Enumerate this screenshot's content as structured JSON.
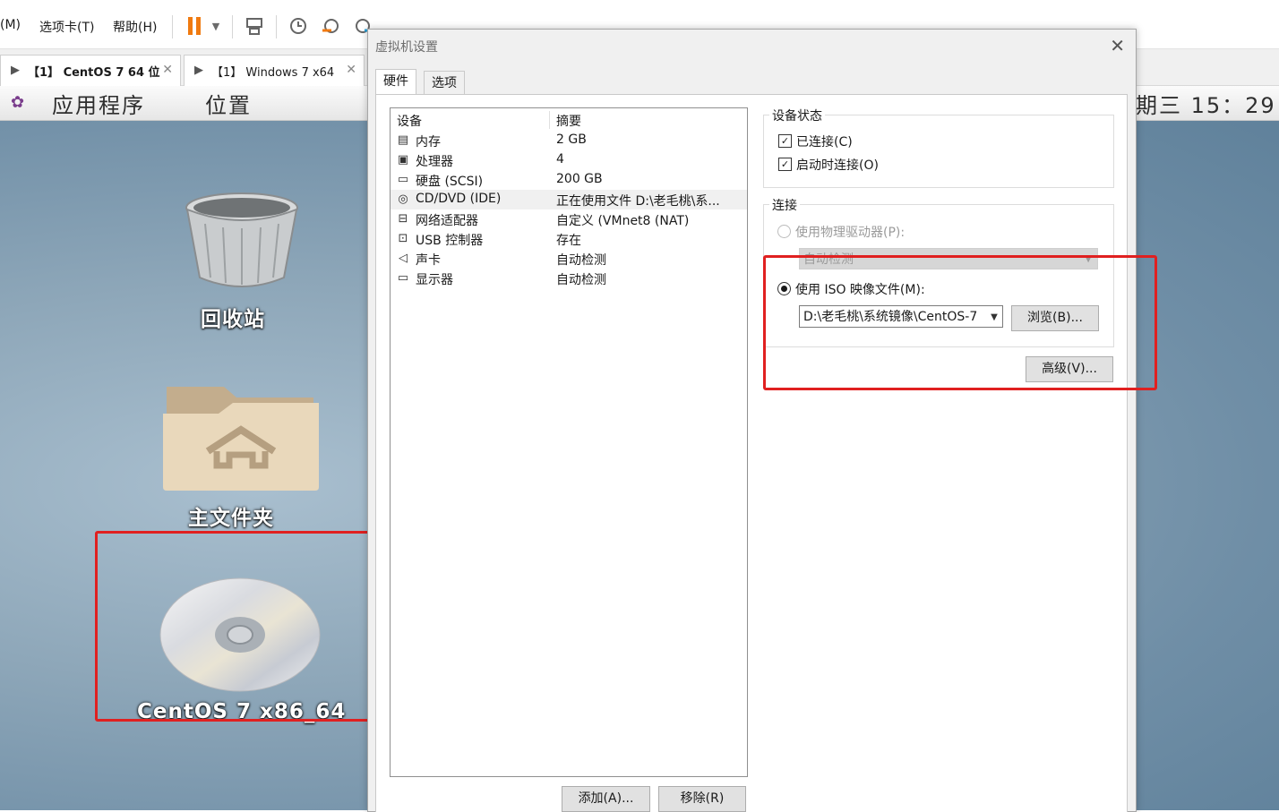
{
  "menubar": {
    "items": [
      "(M)",
      "选项卡(T)",
      "帮助(H)"
    ]
  },
  "tabs": [
    {
      "label": "【1】 CentOS 7 64 位"
    },
    {
      "label": "【1】 Windows 7 x64"
    }
  ],
  "guest": {
    "topbar_apps": "应用程序",
    "topbar_places": "位置",
    "clock": "期三 15：29",
    "icons": [
      {
        "label": "回收站"
      },
      {
        "label": "主文件夹"
      },
      {
        "label": "CentOS 7 x86_64"
      }
    ]
  },
  "dialog": {
    "title": "虚拟机设置",
    "tabs": [
      "硬件",
      "选项"
    ],
    "device_list": {
      "headers": [
        "设备",
        "摘要"
      ],
      "rows": [
        {
          "icon": "memory-icon",
          "device": "内存",
          "summary": "2 GB"
        },
        {
          "icon": "processor-icon",
          "device": "处理器",
          "summary": "4"
        },
        {
          "icon": "hard-disk-icon",
          "device": "硬盘 (SCSI)",
          "summary": "200 GB"
        },
        {
          "icon": "cd-dvd-icon",
          "device": "CD/DVD (IDE)",
          "summary": "正在使用文件 D:\\老毛桃\\系..."
        },
        {
          "icon": "network-adapter-icon",
          "device": "网络适配器",
          "summary": "自定义 (VMnet8 (NAT)"
        },
        {
          "icon": "usb-controller-icon",
          "device": "USB 控制器",
          "summary": "存在"
        },
        {
          "icon": "sound-card-icon",
          "device": "声卡",
          "summary": "自动检测"
        },
        {
          "icon": "display-icon",
          "device": "显示器",
          "summary": "自动检测"
        }
      ]
    },
    "add_button": "添加(A)...",
    "remove_button": "移除(R)",
    "device_status": {
      "title": "设备状态",
      "connected": "已连接(C)",
      "connect_at_power_on": "启动时连接(O)"
    },
    "connection": {
      "title": "连接",
      "physical_drive": "使用物理驱动器(P):",
      "physical_drive_value": "自动检测",
      "iso_file": "使用 ISO 映像文件(M):",
      "iso_path": "D:\\老毛桃\\系统镜像\\CentOS-7",
      "browse_button": "浏览(B)...",
      "advanced_button": "高级(V)..."
    }
  }
}
